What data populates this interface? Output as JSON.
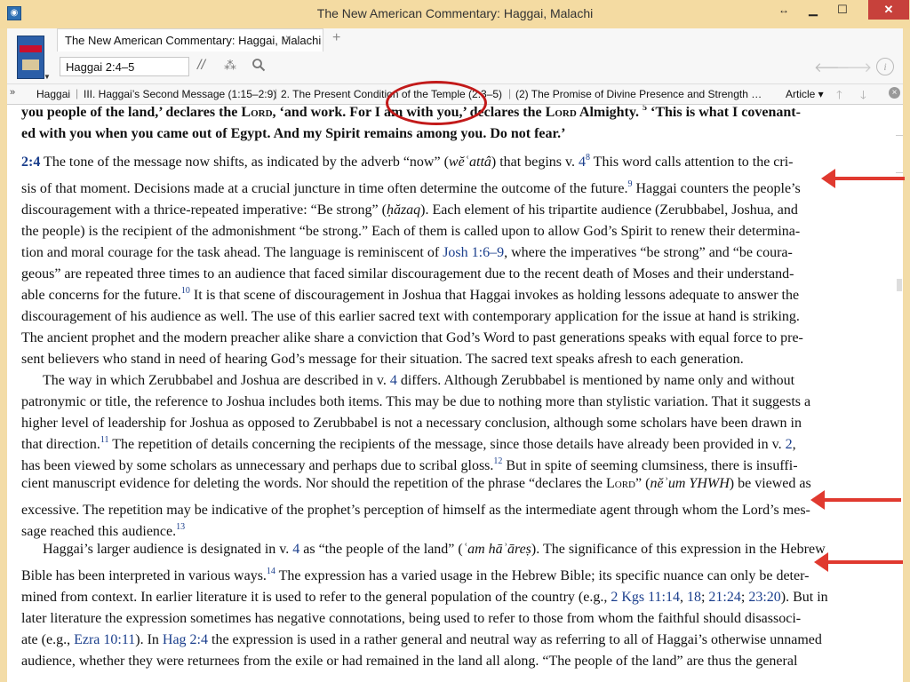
{
  "window": {
    "title": "The New American Commentary: Haggai, Malachi",
    "minimize": "▁",
    "maximize": "☐",
    "close": "✕",
    "restore": "↔"
  },
  "tab": {
    "label": "The New American Commentary: Haggai, Malachi",
    "close": "×",
    "add": "+"
  },
  "toolbar": {
    "reference": "Haggai 2:4–5",
    "parallel": "//",
    "dots": "⁂"
  },
  "breadcrumb": {
    "toggle": "»",
    "items": [
      "Haggai",
      "III. Haggai’s Second Message (1:15–2:9)",
      "2. The Present Condition of the Temple (2:3–5)",
      "(2) The Promise of Divine Presence and Strength …"
    ],
    "article": "Article ▾"
  },
  "icons": {
    "back": "🡐",
    "forward": "🡒",
    "info": "i",
    "up": "🡑",
    "down": "🡓",
    "close_pane": "×"
  },
  "text": {
    "l1a": "you people of the land,’ declares the ",
    "l1lord": "Lord",
    "l1b": ", ‘and work. For I am with you,’ declares the ",
    "l1lord2": "Lord",
    "l1c": " Almighty. ",
    "l1sup": "5",
    "l1d": " ‘This is what I covenant-",
    "l2": "ed with you when you came out of Egypt. And my Spirit remains among you. Do not fear.’",
    "l3ref": "2:4",
    "l3a": " The tone of the message now shifts, as indicated by the adverb “now” (",
    "l3i": "wĕʿattâ",
    "l3b": ") that begins v. ",
    "l3v": "4",
    "l3sup": "8",
    "l3c": " This word calls attention to the cri-",
    "l4a": "sis of that moment. Decisions made at a crucial juncture in time often determine the outcome of the future.",
    "l4sup": "9",
    "l4b": " Haggai counters the people’s",
    "l5a": "discouragement with a thrice-repeated imperative: “Be strong” (",
    "l5i": "ḥăzaq",
    "l5b": "). Each element of his tripartite audience (Zerubbabel, Joshua, and",
    "l6": "the people) is the recipient of the admonishment “be strong.” Each of them is called upon to allow God’s Spirit to renew their determina-",
    "l7a": "tion and moral courage for the task ahead. The language is reminiscent of ",
    "l7ref": "Josh 1:6–9",
    "l7b": ", where the imperatives “be strong” and “be coura-",
    "l8": "geous” are repeated three times to an audience that faced similar discouragement due to the recent death of Moses and their understand-",
    "l9a": "able concerns for the future.",
    "l9sup": "10",
    "l9b": " It is that scene of discouragement in Joshua that Haggai invokes as holding lessons adequate to answer the",
    "l10": "discouragement of his audience as well. The use of this earlier sacred text with contemporary application for the issue at hand is striking.",
    "l11": "The ancient prophet and the modern preacher alike share a conviction that God’s Word to past generations speaks with equal force to pre-",
    "l12": "sent believers who stand in need of hearing God’s message for their situation. The sacred text speaks afresh to each generation.",
    "l13a": "The way in which Zerubbabel and Joshua are described in v. ",
    "l13v": "4",
    "l13b": " differs. Although Zerubbabel is mentioned by name only and without",
    "l14": "patronymic or title, the reference to Joshua includes both items. This may be due to nothing more than stylistic variation. That it suggests a",
    "l15": "higher level of leadership for Joshua as opposed to Zerubbabel is not a necessary conclusion, although some scholars have been drawn in",
    "l16a": "that direction.",
    "l16sup": "11",
    "l16b": " The repetition of details concerning the recipients of the message, since those details have already been provided in v. ",
    "l16v": "2",
    "l16c": ",",
    "l17a": "has been viewed by some scholars as unnecessary and perhaps due to scribal gloss.",
    "l17sup": "12",
    "l17b": " But in spite of seeming clumsiness, there is insuffi-",
    "l18a": "cient manuscript evidence for deleting the words. Nor should the repetition of the phrase “declares the ",
    "l18lord": "Lord",
    "l18b": "” (",
    "l18i": "nĕʾum YHWH",
    "l18c": ") be viewed as",
    "l19": "excessive. The repetition may be indicative of the prophet’s perception of himself as the intermediate agent through whom the Lord’s mes-",
    "l20a": "sage reached this audience.",
    "l20sup": "13",
    "l21a": "Haggai’s larger audience is designated in v. ",
    "l21v": "4",
    "l21b": " as “the people of the land” (",
    "l21i": "ʿam hāʾāreṣ",
    "l21c": "). The significance of this expression in the Hebrew",
    "l22a": "Bible has been interpreted in various ways.",
    "l22sup": "14",
    "l22b": " The expression has a varied usage in the Hebrew Bible; its specific nuance can only be deter-",
    "l23a": "mined from context. In earlier literature it is used to refer to the general population of the country (e.g., ",
    "l23r1": "2 Kgs 11:14",
    "l23s1": ", ",
    "l23r2": "18",
    "l23s2": "; ",
    "l23r3": "21:24",
    "l23s3": "; ",
    "l23r4": "23:20",
    "l23b": "). But in",
    "l24": "later literature the expression sometimes has negative connotations, being used to refer to those from whom the faithful should disassoci-",
    "l25a": "ate (e.g., ",
    "l25r1": "Ezra 10:11",
    "l25b": "). In ",
    "l25r2": "Hag 2:4",
    "l25c": " the expression is used in a rather general and neutral way as referring to all of Haggai’s otherwise unnamed",
    "l26": "audience, whether they were returnees from the exile or had remained in the land all along. “The people of the land” are thus the general"
  }
}
